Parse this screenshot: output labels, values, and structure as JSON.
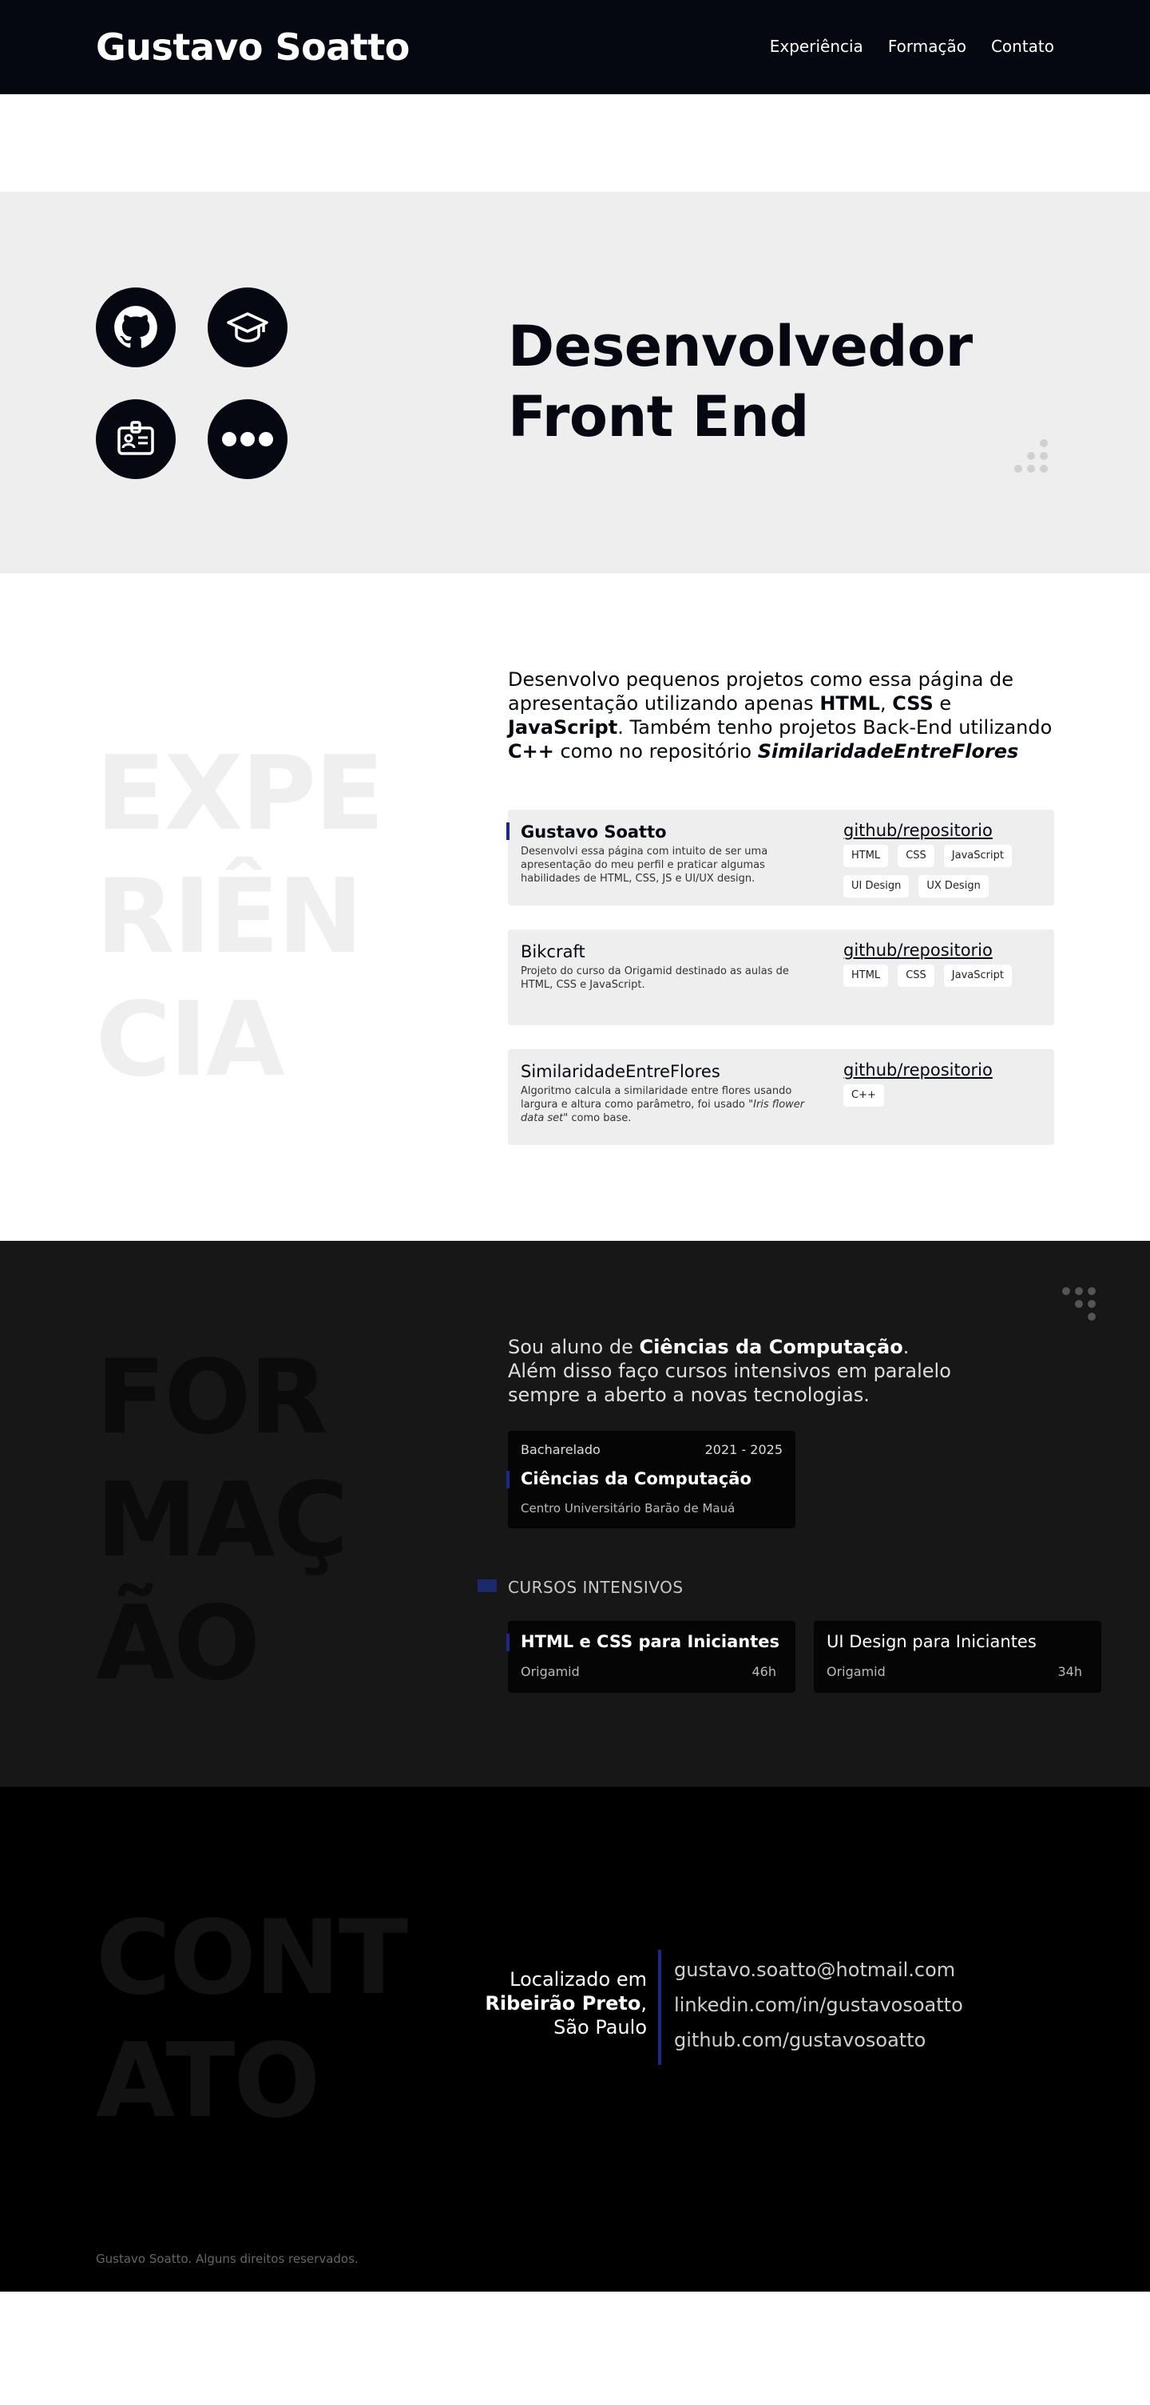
{
  "header": {
    "brand": "Gustavo Soatto",
    "nav": [
      "Experiência",
      "Formação",
      "Contato"
    ]
  },
  "hero": {
    "icons": [
      "github-icon",
      "graduation-cap-icon",
      "id-badge-icon",
      "more-icon"
    ],
    "title_line1": "Desenvolvedor",
    "title_line2": "Front End"
  },
  "experience": {
    "big_word": [
      "EXPE",
      "RIÊN",
      "CIA"
    ],
    "intro": {
      "p1": "Desenvolvo pequenos projetos como essa página de apresentação utilizando apenas ",
      "html": "HTML",
      "sep1": ", ",
      "css": "CSS",
      "sep2": " e ",
      "js": "JavaScript",
      "p2": ". Também tenho projetos Back-End utilizando ",
      "cpp": "C++",
      "p3": " como no repositório ",
      "repo": "SimilaridadeEntreFlores"
    },
    "projects": [
      {
        "title": "Gustavo Soatto",
        "desc": "Desenvolvi essa página com intuito de ser uma apresentação do meu perfil e praticar algumas habilidades de HTML, CSS, JS e UI/UX design.",
        "repo": "github/repositorio",
        "tags": [
          "HTML",
          "CSS",
          "JavaScript",
          "UI Design",
          "UX Design"
        ]
      },
      {
        "title": "Bikcraft",
        "desc": "Projeto do curso da Origamid destinado as aulas de HTML, CSS e JavaScript.",
        "repo": "github/repositorio",
        "tags": [
          "HTML",
          "CSS",
          "JavaScript"
        ]
      },
      {
        "title": "SimilaridadeEntreFlores",
        "desc_pre": "Algoritmo calcula a similaridade entre flores usando largura e altura como parâmetro, foi usado \"",
        "desc_em": "Iris flower data set",
        "desc_post": "\" como base.",
        "repo": "github/repositorio",
        "tags": [
          "C++"
        ]
      }
    ]
  },
  "formacao": {
    "big_word": [
      "FOR",
      "MAÇ",
      "ÃO"
    ],
    "intro": {
      "p1": "Sou aluno de ",
      "course": "Ciências da Computação",
      "p2": ".",
      "line2": "Além disso faço cursos intensivos em paralelo sempre a aberto a novas tecnologias."
    },
    "degree": {
      "type": "Bacharelado",
      "years": "2021 - 2025",
      "name": "Ciências da Computação",
      "institution": "Centro Universitário Barão de Mauá"
    },
    "courses_label": "CURSOS INTENSIVOS",
    "courses": [
      {
        "name": "HTML e CSS para Iniciantes",
        "institution": "Origamid",
        "hours": "46h"
      },
      {
        "name": "UI Design para Iniciantes",
        "institution": "Origamid",
        "hours": "34h"
      }
    ]
  },
  "contato": {
    "big_word": [
      "CONT",
      "ATO"
    ],
    "location": {
      "l1": "Localizado em",
      "city": "Ribeirão Preto",
      "comma": ",",
      "state": "São Paulo"
    },
    "links": [
      "gustavo.soatto@hotmail.com",
      "linkedin.com/in/gustavosoatto",
      "github.com/gustavosoatto"
    ],
    "footer": "Gustavo Soatto. Alguns direitos reservados."
  }
}
